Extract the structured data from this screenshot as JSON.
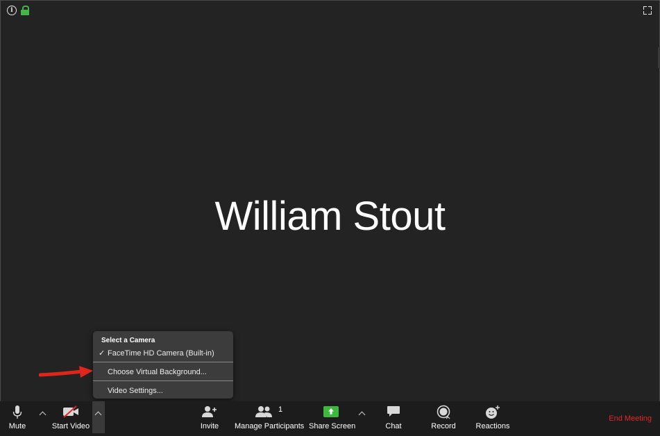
{
  "participant": {
    "name": "William Stout"
  },
  "camera_menu": {
    "header": "Select a Camera",
    "camera": "FaceTime HD Camera (Built-in)",
    "camera_selected": true,
    "virtual_background": "Choose Virtual Background...",
    "video_settings": "Video Settings..."
  },
  "toolbar": {
    "mute": "Mute",
    "start_video": "Start Video",
    "invite": "Invite",
    "manage_participants": "Manage Participants",
    "participant_count": "1",
    "share_screen": "Share Screen",
    "chat": "Chat",
    "record": "Record",
    "reactions": "Reactions",
    "end_meeting": "End Meeting"
  },
  "colors": {
    "background": "#232323",
    "toolbar": "#1c1c1c",
    "menu": "#3c3c3c",
    "share_green": "#3cb83c",
    "end_red": "#e02828",
    "lock_green": "#45b54a",
    "arrow_red": "#e0261b"
  },
  "icons": [
    "info-icon",
    "lock-icon",
    "fullscreen-icon",
    "microphone-icon",
    "video-off-icon",
    "invite-icon",
    "participants-icon",
    "share-screen-icon",
    "chat-icon",
    "record-icon",
    "reactions-icon"
  ]
}
